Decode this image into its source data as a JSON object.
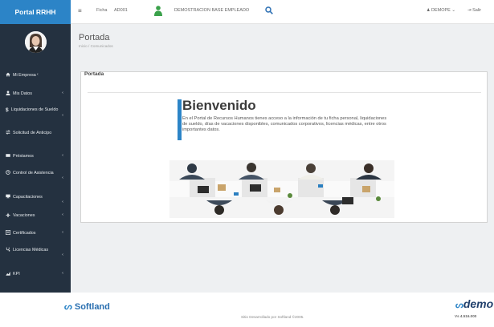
{
  "app": {
    "title": "Portal RRHH"
  },
  "sidebar": {
    "items": [
      {
        "label": "Mi Empresa",
        "icon": "home-icon"
      },
      {
        "label": "Mis Datos",
        "icon": "user-icon"
      },
      {
        "label": "Liquidaciones de Sueldo",
        "icon": "dollar-icon"
      },
      {
        "label": "Solicitud de Anticipo",
        "icon": "transfer-icon"
      },
      {
        "label": "Préstamos",
        "icon": "card-icon"
      },
      {
        "label": "Control de Asistencia",
        "icon": "clock-icon"
      },
      {
        "label": "Capacitaciones",
        "icon": "board-icon"
      },
      {
        "label": "Vacaciones",
        "icon": "plane-icon"
      },
      {
        "label": "Certificados",
        "icon": "certificate-icon"
      },
      {
        "label": "Licencias Médicas",
        "icon": "stethoscope-icon"
      },
      {
        "label": "KPI",
        "icon": "chart-icon"
      }
    ]
  },
  "topbar": {
    "ficha_label": "Ficha",
    "ficha_value": "AD001",
    "user_name": "DEMOSTRACION BASE EMPLEADO",
    "account": "DEMOPE",
    "logout": "Salir"
  },
  "page": {
    "title": "Portada",
    "breadcrumb_home": "Inicio",
    "breadcrumb_sep": "/",
    "breadcrumb_current": "Comunicados",
    "panel_title": "Portada"
  },
  "welcome": {
    "title": "Bienvenido",
    "text": "En el Portal de Recursos Humanos tienes acceso a la información de tu ficha personal, liquidaciones de sueldo, días de vacaciones disponibles, comunicados corporativos, licencias médicas, entre otros importantes datos."
  },
  "footer": {
    "logo": "Softland",
    "center": "Sitio Desarrollado por Softland ©2005.",
    "demo_logo": "demo",
    "version": "Vs 4.516.000"
  },
  "colors": {
    "sidebar_bg": "#243140",
    "brand_blue": "#2c84c7",
    "user_icon_green": "#3aa14a",
    "search_icon": "#2c6fb3"
  }
}
